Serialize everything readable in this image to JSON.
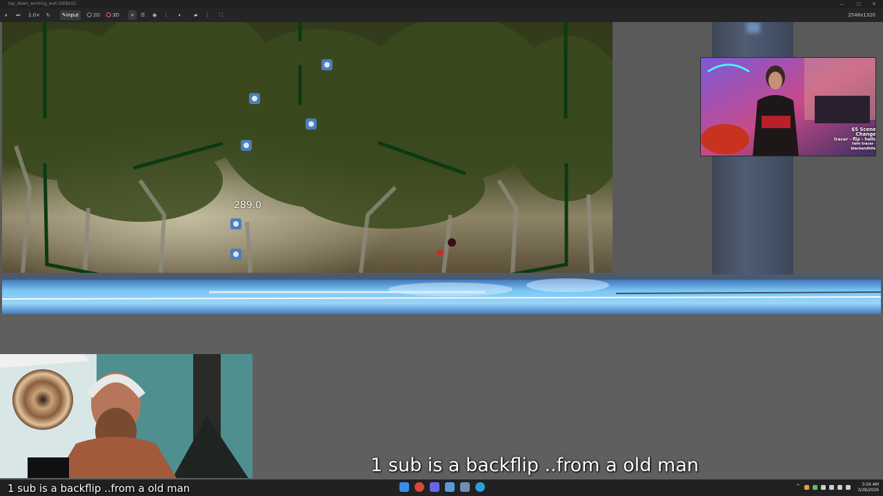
{
  "window": {
    "title": "top_down_working_wall (DEBUG)"
  },
  "toolbar": {
    "zoom": "1.0×",
    "input_label": "Input",
    "mode_2d": "2D",
    "mode_3d": "3D",
    "resolution": "2548x1320"
  },
  "game": {
    "score": "289.0"
  },
  "captions": {
    "main": "1 sub is a backflip ..from a old man",
    "small": "1 sub is a backflip ..from a old man"
  },
  "guest_cam": {
    "overlay_line1": "$5 Scene Change",
    "overlay_line2": "tracer - flip - hello",
    "overlay_line3": "twin tracer - blackandhite"
  },
  "taskbar": {
    "time": "3:56 AM",
    "date": "3/28/2026"
  },
  "colors": {
    "accent": "#4a9be8",
    "wall_green": "#0f3d14",
    "stream_blue": "#5fb0f0"
  }
}
